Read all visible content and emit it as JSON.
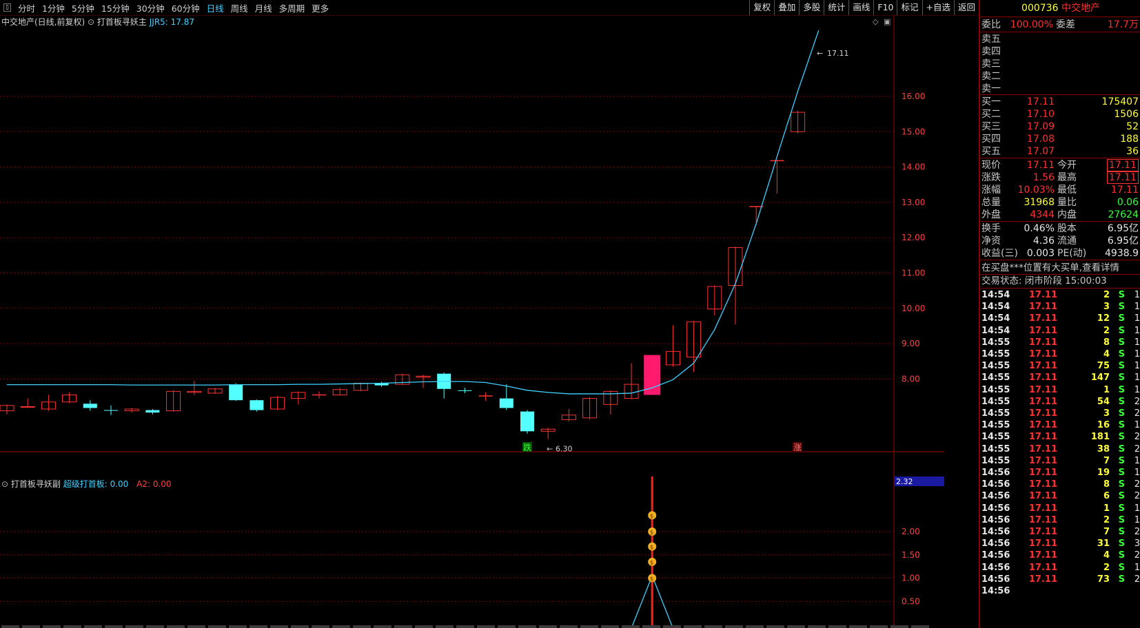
{
  "toolbar": {
    "left_items": [
      "分时",
      "1分钟",
      "5分钟",
      "15分钟",
      "30分钟",
      "60分钟",
      "日线",
      "周线",
      "月线",
      "多周期",
      "更多"
    ],
    "active": "日线",
    "right_items": [
      "复权",
      "叠加",
      "多股",
      "统计",
      "画线",
      "F10",
      "标记",
      "+自选",
      "返回"
    ]
  },
  "main_chart": {
    "title": "中交地产(日线,前复权)",
    "indicator_name": "打首板寻妖主",
    "indicator_value": "JJR5: 17.87",
    "price_label_high": "17.11",
    "price_label_low": "6.30",
    "marker_down": "跌",
    "marker_up": "涨"
  },
  "sub_chart": {
    "title": "打首板寻妖副",
    "line1": "超级打首板: 0.00",
    "line2": "A2: 0.00",
    "current_value": "2.32"
  },
  "chart_data": [
    {
      "type": "candlestick",
      "y_axis_ticks": [
        "16.00",
        "15.00",
        "14.00",
        "13.00",
        "12.00",
        "11.00",
        "10.00",
        "9.00",
        "8.00"
      ],
      "ylim": [
        6.0,
        18.0
      ],
      "candles": [
        {
          "o": 7.1,
          "c": 7.25,
          "h": 7.28,
          "l": 7.0
        },
        {
          "o": 7.2,
          "c": 7.22,
          "h": 7.45,
          "l": 7.18
        },
        {
          "o": 7.15,
          "c": 7.35,
          "h": 7.55,
          "l": 7.1
        },
        {
          "o": 7.35,
          "c": 7.55,
          "h": 7.62,
          "l": 7.32
        },
        {
          "o": 7.3,
          "c": 7.18,
          "h": 7.4,
          "l": 7.1
        },
        {
          "o": 7.12,
          "c": 7.1,
          "h": 7.25,
          "l": 6.98
        },
        {
          "o": 7.1,
          "c": 7.15,
          "h": 7.18,
          "l": 7.05
        },
        {
          "o": 7.12,
          "c": 7.05,
          "h": 7.15,
          "l": 7.0
        },
        {
          "o": 7.1,
          "c": 7.65,
          "h": 7.68,
          "l": 7.08
        },
        {
          "o": 7.62,
          "c": 7.65,
          "h": 7.95,
          "l": 7.55
        },
        {
          "o": 7.6,
          "c": 7.72,
          "h": 7.75,
          "l": 7.58
        },
        {
          "o": 7.85,
          "c": 7.4,
          "h": 7.88,
          "l": 7.38
        },
        {
          "o": 7.4,
          "c": 7.12,
          "h": 7.42,
          "l": 7.08
        },
        {
          "o": 7.15,
          "c": 7.48,
          "h": 7.52,
          "l": 7.12
        },
        {
          "o": 7.45,
          "c": 7.62,
          "h": 7.65,
          "l": 7.28
        },
        {
          "o": 7.55,
          "c": 7.55,
          "h": 7.65,
          "l": 7.45
        },
        {
          "o": 7.55,
          "c": 7.7,
          "h": 7.75,
          "l": 7.53
        },
        {
          "o": 7.68,
          "c": 7.88,
          "h": 7.9,
          "l": 7.65
        },
        {
          "o": 7.88,
          "c": 7.82,
          "h": 7.92,
          "l": 7.78
        },
        {
          "o": 7.85,
          "c": 8.12,
          "h": 8.15,
          "l": 7.83
        },
        {
          "o": 8.05,
          "c": 8.08,
          "h": 8.12,
          "l": 7.75
        },
        {
          "o": 8.15,
          "c": 7.72,
          "h": 8.18,
          "l": 7.45
        },
        {
          "o": 7.68,
          "c": 7.66,
          "h": 7.75,
          "l": 7.6
        },
        {
          "o": 7.52,
          "c": 7.52,
          "h": 7.62,
          "l": 7.38
        },
        {
          "o": 7.45,
          "c": 7.18,
          "h": 7.85,
          "l": 7.12
        },
        {
          "o": 7.08,
          "c": 6.52,
          "h": 7.12,
          "l": 6.45
        },
        {
          "o": 6.52,
          "c": 6.58,
          "h": 6.62,
          "l": 6.3
        },
        {
          "o": 6.85,
          "c": 6.98,
          "h": 7.15,
          "l": 6.8
        },
        {
          "o": 6.9,
          "c": 7.45,
          "h": 7.48,
          "l": 6.85
        },
        {
          "o": 7.28,
          "c": 7.65,
          "h": 7.68,
          "l": 7.0
        },
        {
          "o": 7.45,
          "c": 7.85,
          "h": 8.45,
          "l": 7.43
        },
        {
          "o": 7.55,
          "c": 8.68,
          "h": 8.68,
          "l": 7.55
        },
        {
          "o": 8.4,
          "c": 8.78,
          "h": 9.52,
          "l": 8.35
        },
        {
          "o": 8.62,
          "c": 9.62,
          "h": 9.65,
          "l": 8.2
        },
        {
          "o": 9.98,
          "c": 10.62,
          "h": 10.65,
          "l": 9.8
        },
        {
          "o": 10.65,
          "c": 11.72,
          "h": 11.75,
          "l": 9.55
        },
        {
          "o": 12.88,
          "c": 12.88,
          "h": 12.9,
          "l": 12.35
        },
        {
          "o": 14.18,
          "c": 14.18,
          "h": 14.2,
          "l": 13.25
        },
        {
          "o": 15.0,
          "c": 15.55,
          "h": 15.6,
          "l": 14.95
        }
      ],
      "series": [
        {
          "name": "JJR5",
          "values": [
            7.84,
            7.84,
            7.84,
            7.84,
            7.84,
            7.84,
            7.83,
            7.83,
            7.83,
            7.83,
            7.83,
            7.84,
            7.84,
            7.84,
            7.85,
            7.85,
            7.86,
            7.87,
            7.88,
            7.9,
            7.92,
            7.93,
            7.93,
            7.9,
            7.8,
            7.68,
            7.62,
            7.58,
            7.58,
            7.58,
            7.6,
            7.75,
            7.98,
            8.45,
            9.4,
            10.7,
            12.4,
            14.3,
            16.15,
            17.87
          ]
        }
      ]
    },
    {
      "type": "line",
      "y_axis_ticks": [
        "2.00",
        "1.50",
        "1.00",
        "0.50"
      ],
      "ylim": [
        0,
        2.8
      ],
      "signal_index": 31
    }
  ],
  "panel": {
    "code": "000736",
    "name": "中交地产",
    "weibi_label": "委比",
    "weibi_val": "100.00%",
    "weicha_label": "委差",
    "weicha_val": "17.7万",
    "asks": [
      "卖五",
      "卖四",
      "卖三",
      "卖二",
      "卖一"
    ],
    "bids": [
      {
        "label": "买一",
        "price": "17.11",
        "vol": "175407"
      },
      {
        "label": "买二",
        "price": "17.10",
        "vol": "1506"
      },
      {
        "label": "买三",
        "price": "17.09",
        "vol": "52"
      },
      {
        "label": "买四",
        "price": "17.08",
        "vol": "188"
      },
      {
        "label": "买五",
        "price": "17.07",
        "vol": "36"
      }
    ],
    "stats": [
      {
        "l1": "现价",
        "v1": "17.11",
        "l2": "今开",
        "v2": "17.11",
        "c1": "red",
        "c2": "red",
        "box": true
      },
      {
        "l1": "涨跌",
        "v1": "1.56",
        "l2": "最高",
        "v2": "17.11",
        "c1": "red",
        "c2": "red",
        "box": true
      },
      {
        "l1": "涨幅",
        "v1": "10.03%",
        "l2": "最低",
        "v2": "17.11",
        "c1": "red",
        "c2": "red",
        "box": false
      },
      {
        "l1": "总量",
        "v1": "31968",
        "l2": "量比",
        "v2": "0.06",
        "c1": "yel",
        "c2": "grn",
        "box": false
      },
      {
        "l1": "外盘",
        "v1": "4344",
        "l2": "内盘",
        "v2": "27624",
        "c1": "red",
        "c2": "grn",
        "box": false
      }
    ],
    "stats2": [
      {
        "l1": "换手",
        "v1": "0.46%",
        "l2": "股本",
        "v2": "6.95亿"
      },
      {
        "l1": "净资",
        "v1": "4.36",
        "l2": "流通",
        "v2": "6.95亿"
      },
      {
        "l1": "收益(三)",
        "v1": "0.003",
        "l2": "PE(动)",
        "v2": "4938.9"
      }
    ],
    "notice": "在买盘***位置有大买单,查看详情",
    "status": "交易状态: 闭市阶段 15:00:03",
    "ticks": [
      {
        "t": "14:54",
        "p": "17.11",
        "v": "2",
        "s": "S",
        "n": "1"
      },
      {
        "t": "14:54",
        "p": "17.11",
        "v": "3",
        "s": "S",
        "n": "1"
      },
      {
        "t": "14:54",
        "p": "17.11",
        "v": "12",
        "s": "S",
        "n": "1"
      },
      {
        "t": "14:54",
        "p": "17.11",
        "v": "2",
        "s": "S",
        "n": "1"
      },
      {
        "t": "14:55",
        "p": "17.11",
        "v": "8",
        "s": "S",
        "n": "1"
      },
      {
        "t": "14:55",
        "p": "17.11",
        "v": "4",
        "s": "S",
        "n": "1"
      },
      {
        "t": "14:55",
        "p": "17.11",
        "v": "75",
        "s": "S",
        "n": "1"
      },
      {
        "t": "14:55",
        "p": "17.11",
        "v": "147",
        "s": "S",
        "n": "1"
      },
      {
        "t": "14:55",
        "p": "17.11",
        "v": "1",
        "s": "S",
        "n": "1"
      },
      {
        "t": "14:55",
        "p": "17.11",
        "v": "54",
        "s": "S",
        "n": "2"
      },
      {
        "t": "14:55",
        "p": "17.11",
        "v": "3",
        "s": "S",
        "n": "2"
      },
      {
        "t": "14:55",
        "p": "17.11",
        "v": "16",
        "s": "S",
        "n": "1"
      },
      {
        "t": "14:55",
        "p": "17.11",
        "v": "181",
        "s": "S",
        "n": "2"
      },
      {
        "t": "14:55",
        "p": "17.11",
        "v": "38",
        "s": "S",
        "n": "2"
      },
      {
        "t": "14:55",
        "p": "17.11",
        "v": "7",
        "s": "S",
        "n": "1"
      },
      {
        "t": "14:56",
        "p": "17.11",
        "v": "19",
        "s": "S",
        "n": "1"
      },
      {
        "t": "14:56",
        "p": "17.11",
        "v": "8",
        "s": "S",
        "n": "2"
      },
      {
        "t": "14:56",
        "p": "17.11",
        "v": "6",
        "s": "S",
        "n": "2"
      },
      {
        "t": "14:56",
        "p": "17.11",
        "v": "1",
        "s": "S",
        "n": "1"
      },
      {
        "t": "14:56",
        "p": "17.11",
        "v": "2",
        "s": "S",
        "n": "1"
      },
      {
        "t": "14:56",
        "p": "17.11",
        "v": "7",
        "s": "S",
        "n": "2"
      },
      {
        "t": "14:56",
        "p": "17.11",
        "v": "31",
        "s": "S",
        "n": "3"
      },
      {
        "t": "14:56",
        "p": "17.11",
        "v": "4",
        "s": "S",
        "n": "2"
      },
      {
        "t": "14:56",
        "p": "17.11",
        "v": "2",
        "s": "S",
        "n": "1"
      },
      {
        "t": "14:56",
        "p": "17.11",
        "v": "73",
        "s": "S",
        "n": "2"
      },
      {
        "t": "14:56",
        "p": "",
        "v": "",
        "s": "",
        "n": ""
      }
    ]
  }
}
